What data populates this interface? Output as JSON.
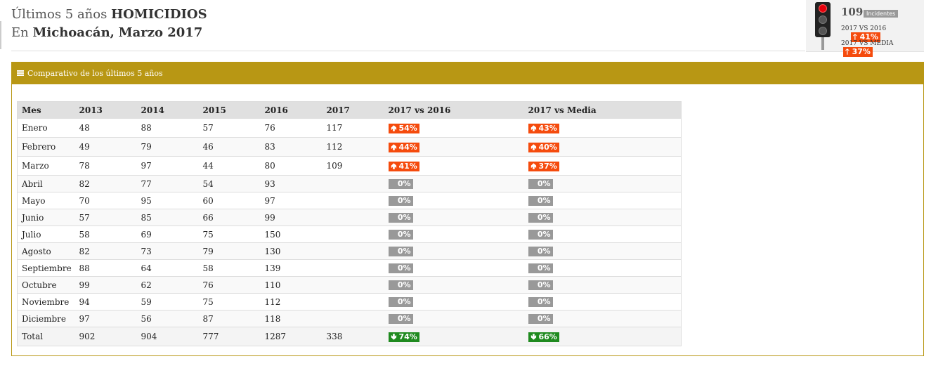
{
  "header": {
    "line1_prefix": "Últimos 5 años",
    "line1_crime": "HOMICIDIOS",
    "line2_prefix": "En",
    "line2_state": "Michoacán,",
    "line2_date": "Marzo 2017"
  },
  "widget": {
    "count": "109",
    "tag": "Incidentes",
    "row1_label": "2017 VS 2016",
    "row1_value": "41%",
    "row2_label": "2017 VS MEDIA",
    "row2_value": "37%",
    "icon": "traffic-light-icon",
    "active_light_color": "#e5000c"
  },
  "panel": {
    "title": "Comparativo de los últimos 5 años",
    "accent": "#b89714"
  },
  "table": {
    "headers": [
      "Mes",
      "2013",
      "2014",
      "2015",
      "2016",
      "2017",
      "2017 vs 2016",
      "2017 vs Media"
    ],
    "rows": [
      {
        "mes": "Enero",
        "y2013": "48",
        "y2014": "88",
        "y2015": "57",
        "y2016": "76",
        "y2017": "117",
        "vs2016": "54%",
        "vsMedia": "43%",
        "trend": "up"
      },
      {
        "mes": "Febrero",
        "y2013": "49",
        "y2014": "79",
        "y2015": "46",
        "y2016": "83",
        "y2017": "112",
        "vs2016": "44%",
        "vsMedia": "40%",
        "trend": "up"
      },
      {
        "mes": "Marzo",
        "y2013": "78",
        "y2014": "97",
        "y2015": "44",
        "y2016": "80",
        "y2017": "109",
        "vs2016": "41%",
        "vsMedia": "37%",
        "trend": "up"
      },
      {
        "mes": "Abril",
        "y2013": "82",
        "y2014": "77",
        "y2015": "54",
        "y2016": "93",
        "y2017": "",
        "vs2016": "0%",
        "vsMedia": "0%",
        "trend": "zero"
      },
      {
        "mes": "Mayo",
        "y2013": "70",
        "y2014": "95",
        "y2015": "60",
        "y2016": "97",
        "y2017": "",
        "vs2016": "0%",
        "vsMedia": "0%",
        "trend": "zero"
      },
      {
        "mes": "Junio",
        "y2013": "57",
        "y2014": "85",
        "y2015": "66",
        "y2016": "99",
        "y2017": "",
        "vs2016": "0%",
        "vsMedia": "0%",
        "trend": "zero"
      },
      {
        "mes": "Julio",
        "y2013": "58",
        "y2014": "69",
        "y2015": "75",
        "y2016": "150",
        "y2017": "",
        "vs2016": "0%",
        "vsMedia": "0%",
        "trend": "zero"
      },
      {
        "mes": "Agosto",
        "y2013": "82",
        "y2014": "73",
        "y2015": "79",
        "y2016": "130",
        "y2017": "",
        "vs2016": "0%",
        "vsMedia": "0%",
        "trend": "zero"
      },
      {
        "mes": "Septiembre",
        "y2013": "88",
        "y2014": "64",
        "y2015": "58",
        "y2016": "139",
        "y2017": "",
        "vs2016": "0%",
        "vsMedia": "0%",
        "trend": "zero"
      },
      {
        "mes": "Octubre",
        "y2013": "99",
        "y2014": "62",
        "y2015": "76",
        "y2016": "110",
        "y2017": "",
        "vs2016": "0%",
        "vsMedia": "0%",
        "trend": "zero"
      },
      {
        "mes": "Noviembre",
        "y2013": "94",
        "y2014": "59",
        "y2015": "75",
        "y2016": "112",
        "y2017": "",
        "vs2016": "0%",
        "vsMedia": "0%",
        "trend": "zero"
      },
      {
        "mes": "Diciembre",
        "y2013": "97",
        "y2014": "56",
        "y2015": "87",
        "y2016": "118",
        "y2017": "",
        "vs2016": "0%",
        "vsMedia": "0%",
        "trend": "zero"
      }
    ],
    "total": {
      "mes": "Total",
      "y2013": "902",
      "y2014": "904",
      "y2015": "777",
      "y2016": "1287",
      "y2017": "338",
      "vs2016": "74%",
      "vsMedia": "66%",
      "trend": "down"
    }
  },
  "colors": {
    "up": "#f54b0d",
    "down": "#1f8a1f",
    "zero": "#999999"
  }
}
